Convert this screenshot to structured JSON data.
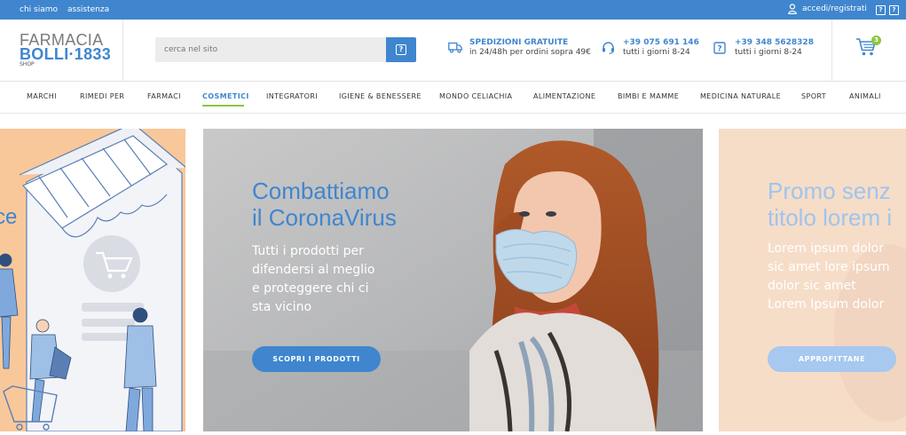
{
  "topbar": {
    "links": [
      "chi siamo",
      "assistenza"
    ],
    "login": "accedi/registrati"
  },
  "header": {
    "logo": {
      "line1": "FARMACIA",
      "line2": "BOLLI·1833",
      "line3": "SHOP"
    },
    "search": {
      "placeholder": "cerca nel sito"
    },
    "shipping": {
      "title": "SPEDIZIONI GRATUITE",
      "text": "in 24/48h per ordini sopra 49€"
    },
    "phone1": {
      "number": "+39 075 691 146",
      "hours": "tutti i giorni 8-24"
    },
    "phone2": {
      "number": "+39 348 5628328",
      "hours": "tutti i giorni 8-24"
    },
    "cart_count": "3"
  },
  "nav": {
    "items": [
      "MARCHI",
      "RIMEDI PER",
      "FARMACI",
      "COSMETICI",
      "INTEGRATORI",
      "IGIENE & BENESSERE",
      "MONDO CELIACHIA",
      "ALIMENTAZIONE",
      "BIMBI E MAMME",
      "MEDICINA NATURALE",
      "SPORT",
      "ANIMALI"
    ],
    "active": "COSMETICI"
  },
  "slides": {
    "left": {
      "fragment": "ce"
    },
    "main": {
      "title_line1": "Combattiamo",
      "title_line2": "il CoronaVirus",
      "text": [
        "Tutti i prodotti per",
        "difendersi al meglio",
        "e proteggere chi ci",
        "sta vicino"
      ],
      "cta": "SCOPRI I PRODOTTI"
    },
    "right": {
      "title_line1": "Promo senz",
      "title_line2": "titolo lorem i",
      "text": [
        "Lorem ipsum dolor",
        "sic amet lore ipsum",
        "dolor sic amet",
        "Lorem Ipsum dolor"
      ],
      "cta": "APPROFITTANE"
    }
  },
  "colors": {
    "brand_blue": "#3f86cf",
    "accent_green": "#8cc63f"
  }
}
